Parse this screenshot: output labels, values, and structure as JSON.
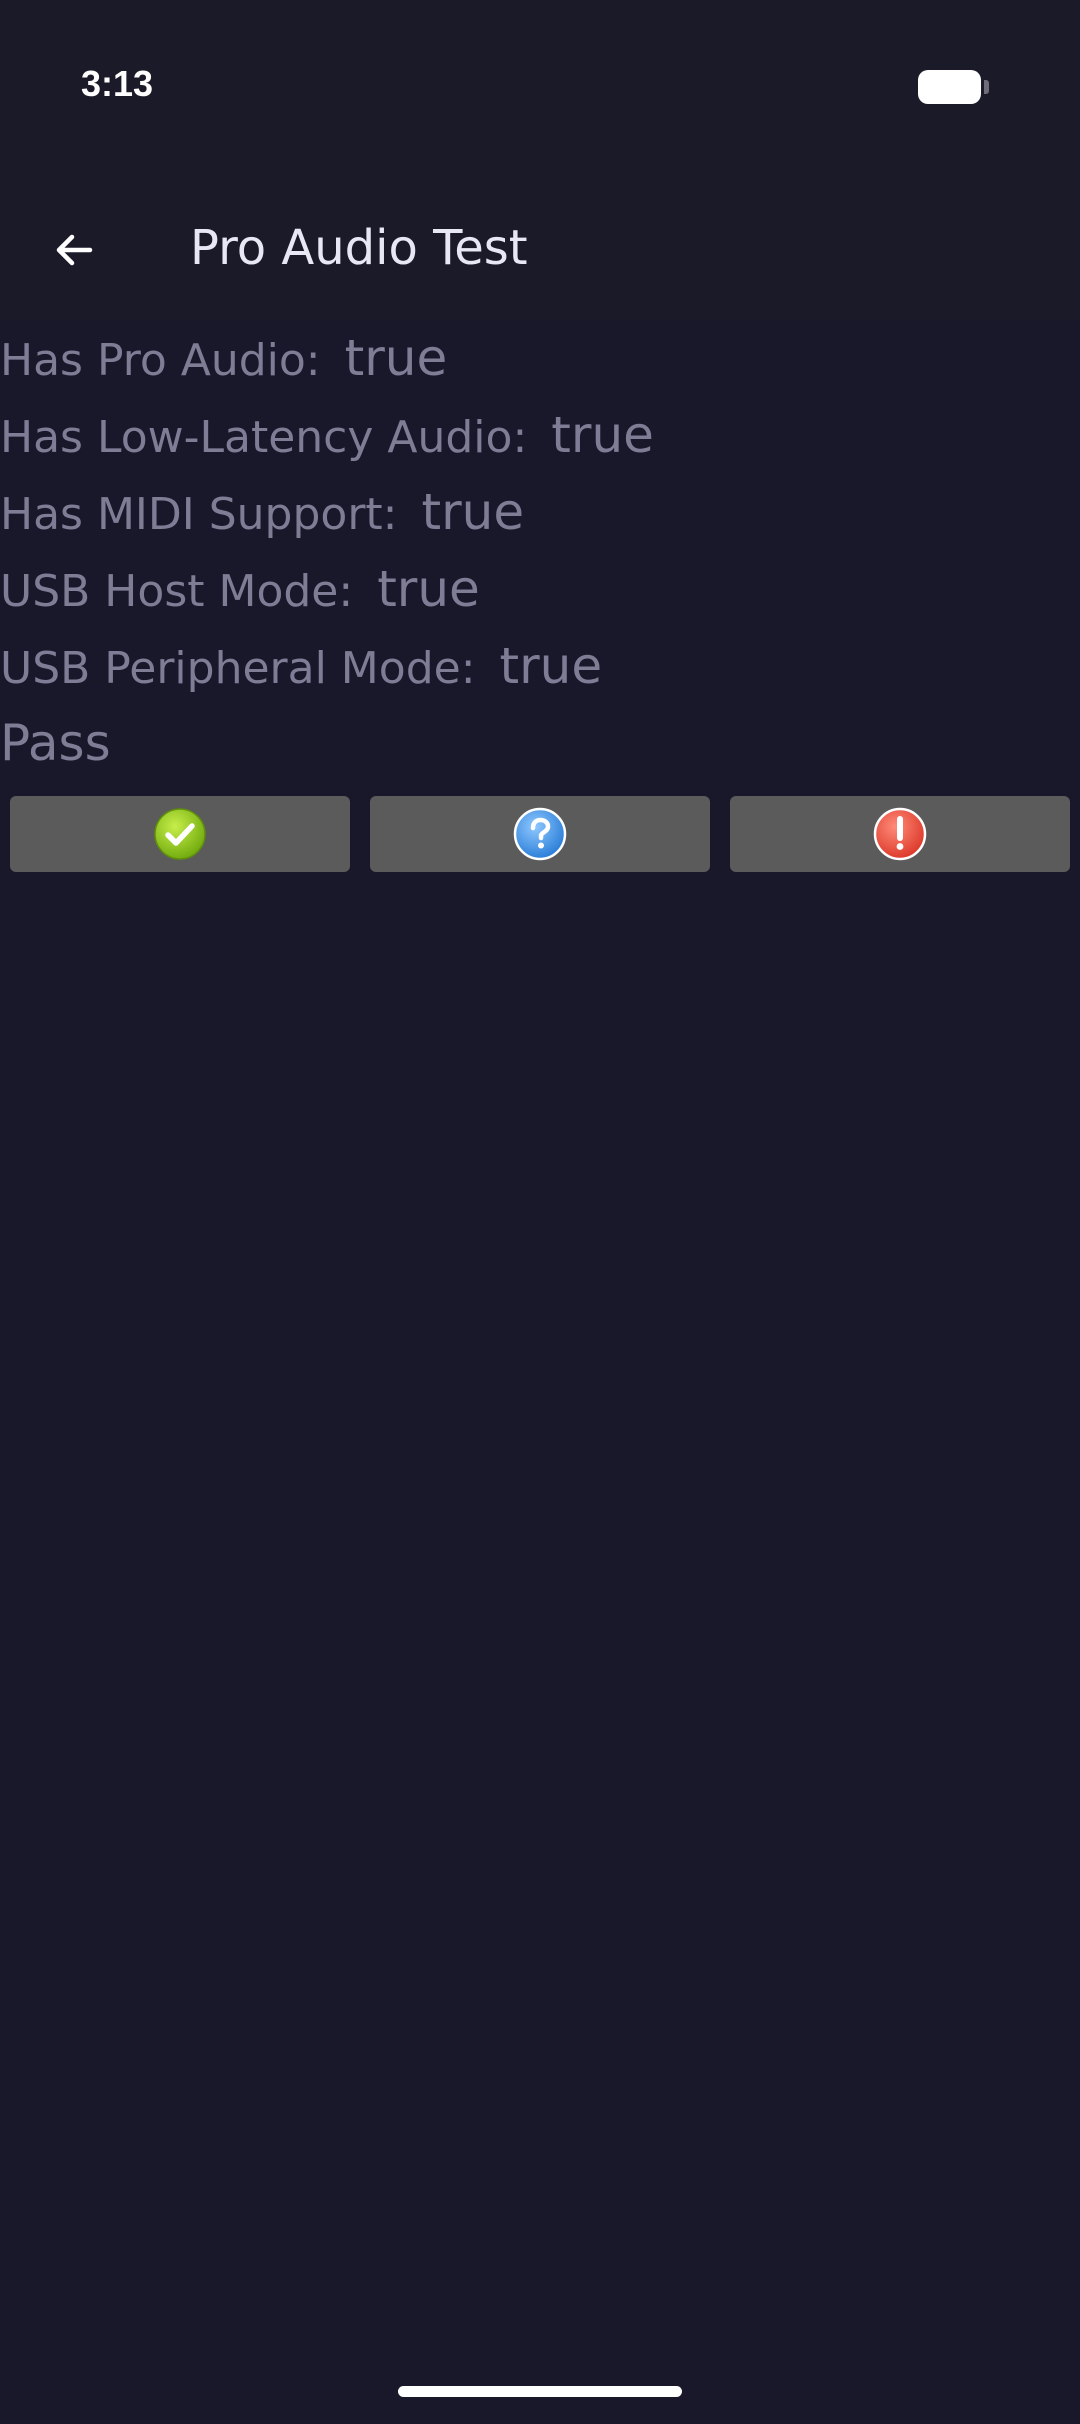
{
  "status_bar": {
    "time": "3:13"
  },
  "app_bar": {
    "title": "Pro Audio Test",
    "back_icon": "arrow-left-icon"
  },
  "info_rows": [
    {
      "label": "Has Pro Audio:",
      "value": "true"
    },
    {
      "label": "Has Low-Latency Audio:",
      "value": "true"
    },
    {
      "label": "Has MIDI Support:",
      "value": "true"
    },
    {
      "label": "USB Host Mode:",
      "value": "true"
    },
    {
      "label": "USB Peripheral Mode:",
      "value": "true"
    }
  ],
  "result_text": "Pass",
  "buttons": [
    {
      "icon": "check-icon",
      "color": "#8cc21f"
    },
    {
      "icon": "question-icon",
      "color": "#3a8ee0"
    },
    {
      "icon": "exclamation-icon",
      "color": "#e74a3a"
    }
  ],
  "colors": {
    "background": "#19182b",
    "app_bar": "#1b1a28",
    "text_muted": "#7e7d95",
    "button_gray": "#5b5b5c"
  }
}
